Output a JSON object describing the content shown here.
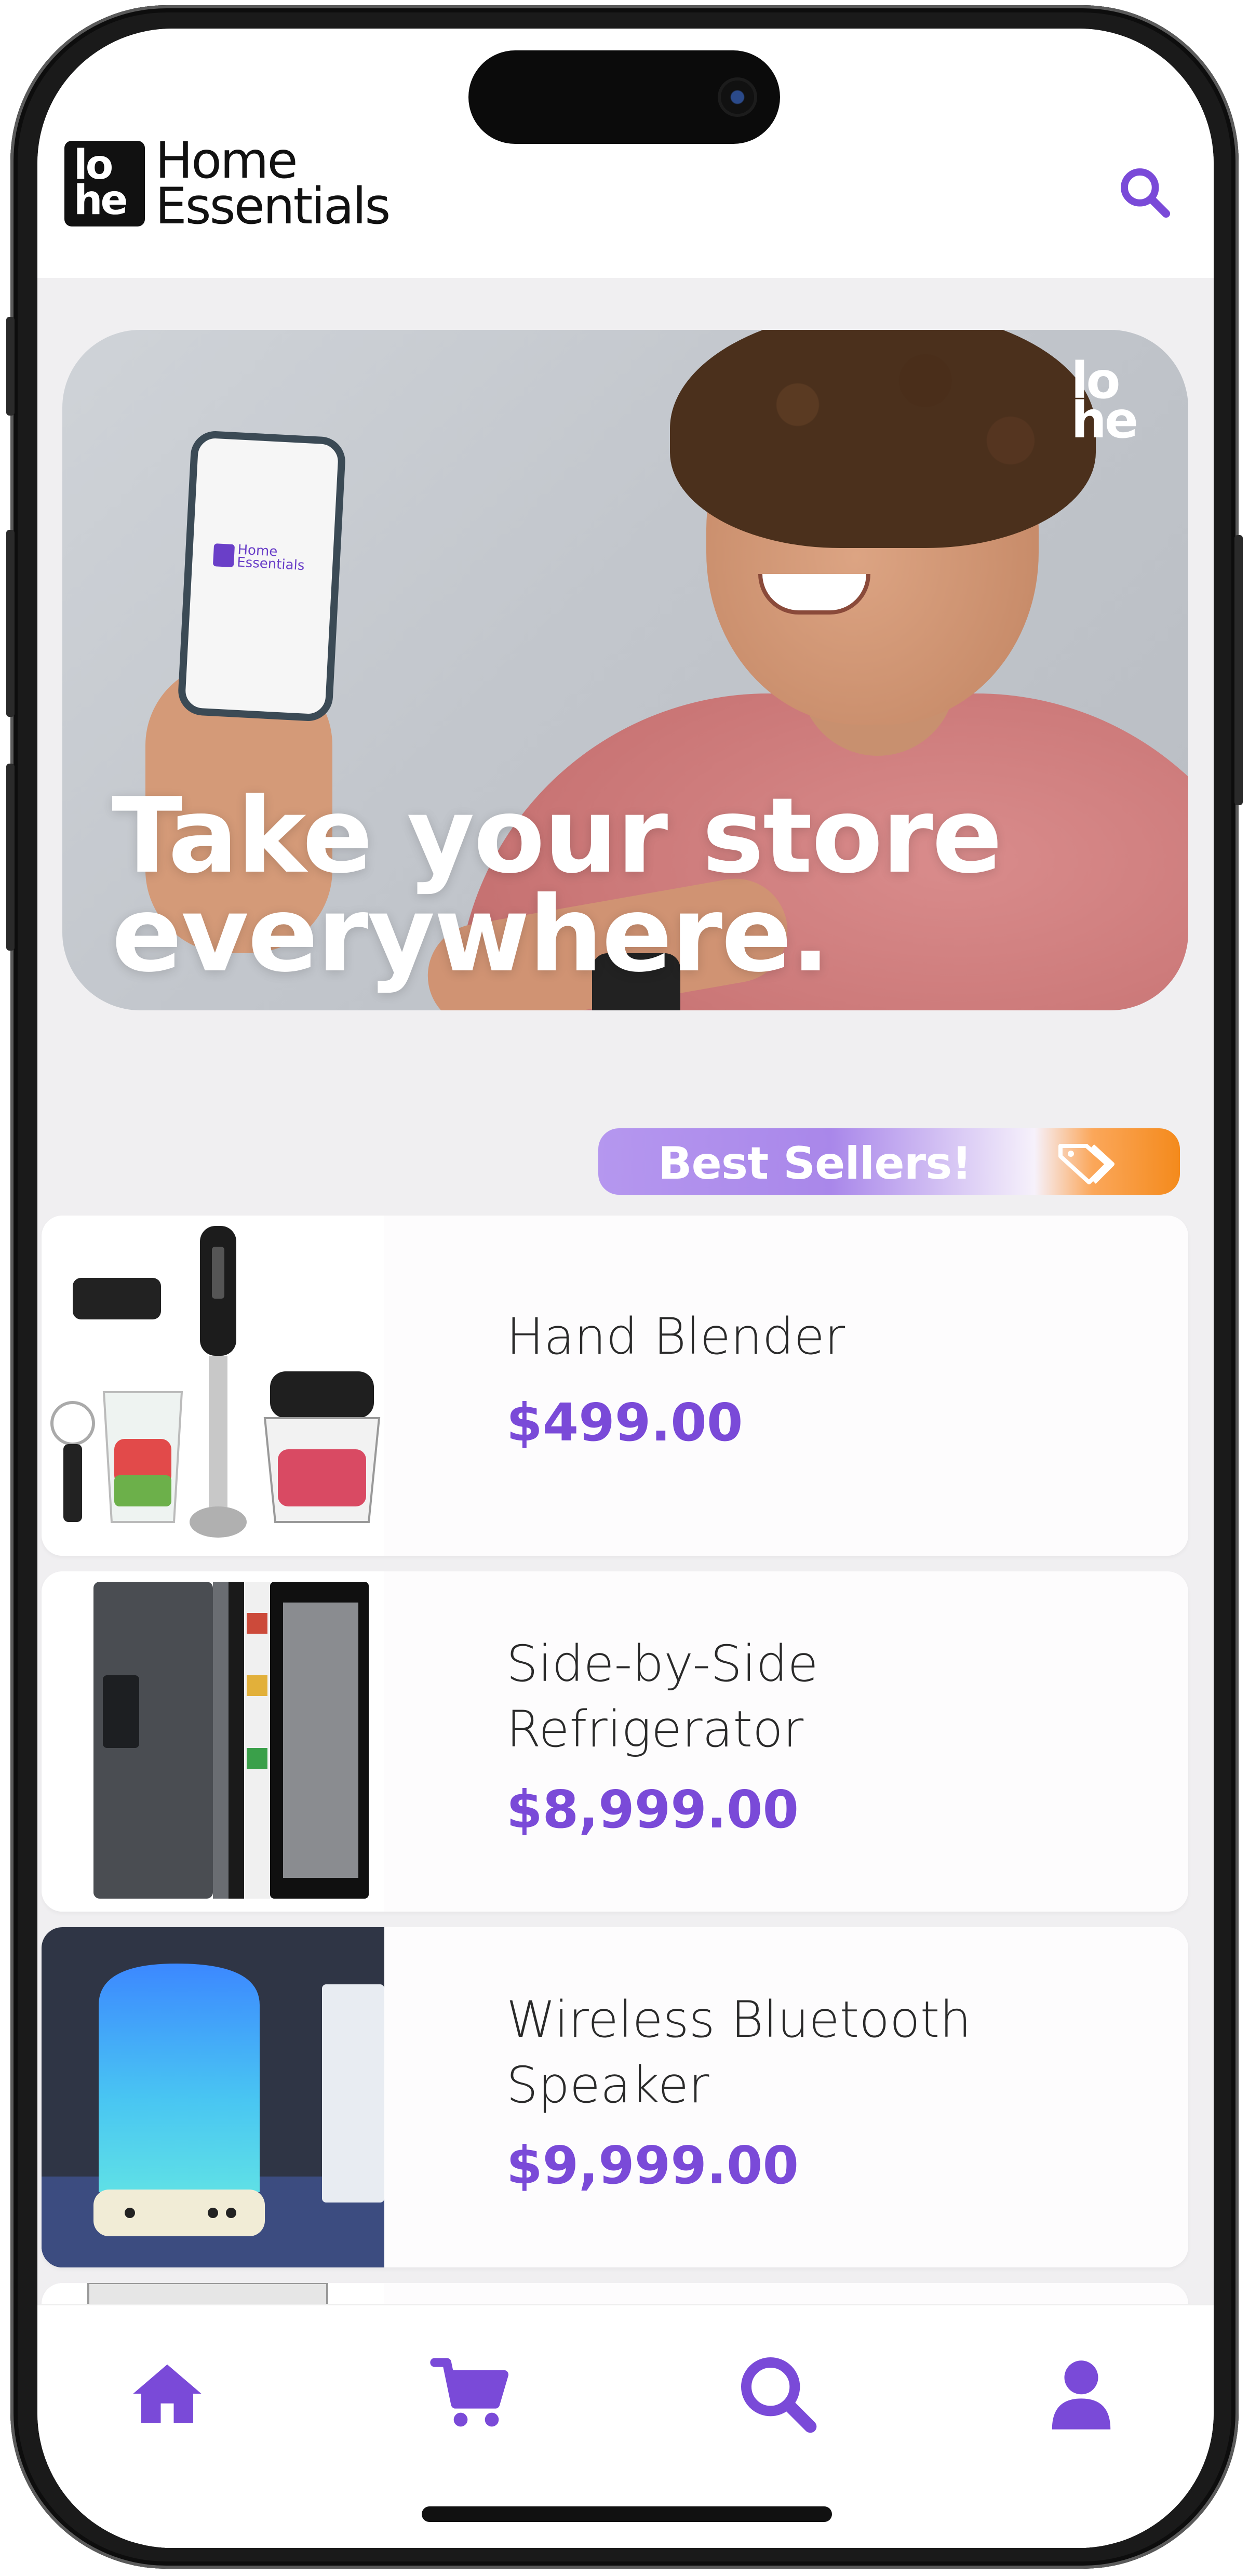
{
  "app": {
    "logo_mark_top": "lo",
    "logo_mark_bottom": "he",
    "logo_line1": "Home",
    "logo_line2": "Essentials",
    "accent_color": "#7a4ad8"
  },
  "header": {
    "search_icon": "search-icon"
  },
  "banner": {
    "headline_line1": "Take your store",
    "headline_line2": "everywhere.",
    "corner_logo_top": "lo",
    "corner_logo_bottom": "he",
    "phone_logo_line1": "Home",
    "phone_logo_line2": "Essentials"
  },
  "best_sellers": {
    "label": "Best Sellers!",
    "icon": "tag-icon"
  },
  "products": [
    {
      "name": "Hand Blender",
      "price": "$499.00"
    },
    {
      "name": "Side-by-Side Refrigerator",
      "price": "$8,999.00"
    },
    {
      "name": "Wireless Bluetooth Speaker",
      "price": "$9,999.00"
    }
  ],
  "bottom_nav": {
    "items": [
      {
        "icon": "home-icon"
      },
      {
        "icon": "cart-icon"
      },
      {
        "icon": "search-icon"
      },
      {
        "icon": "user-icon"
      }
    ]
  }
}
